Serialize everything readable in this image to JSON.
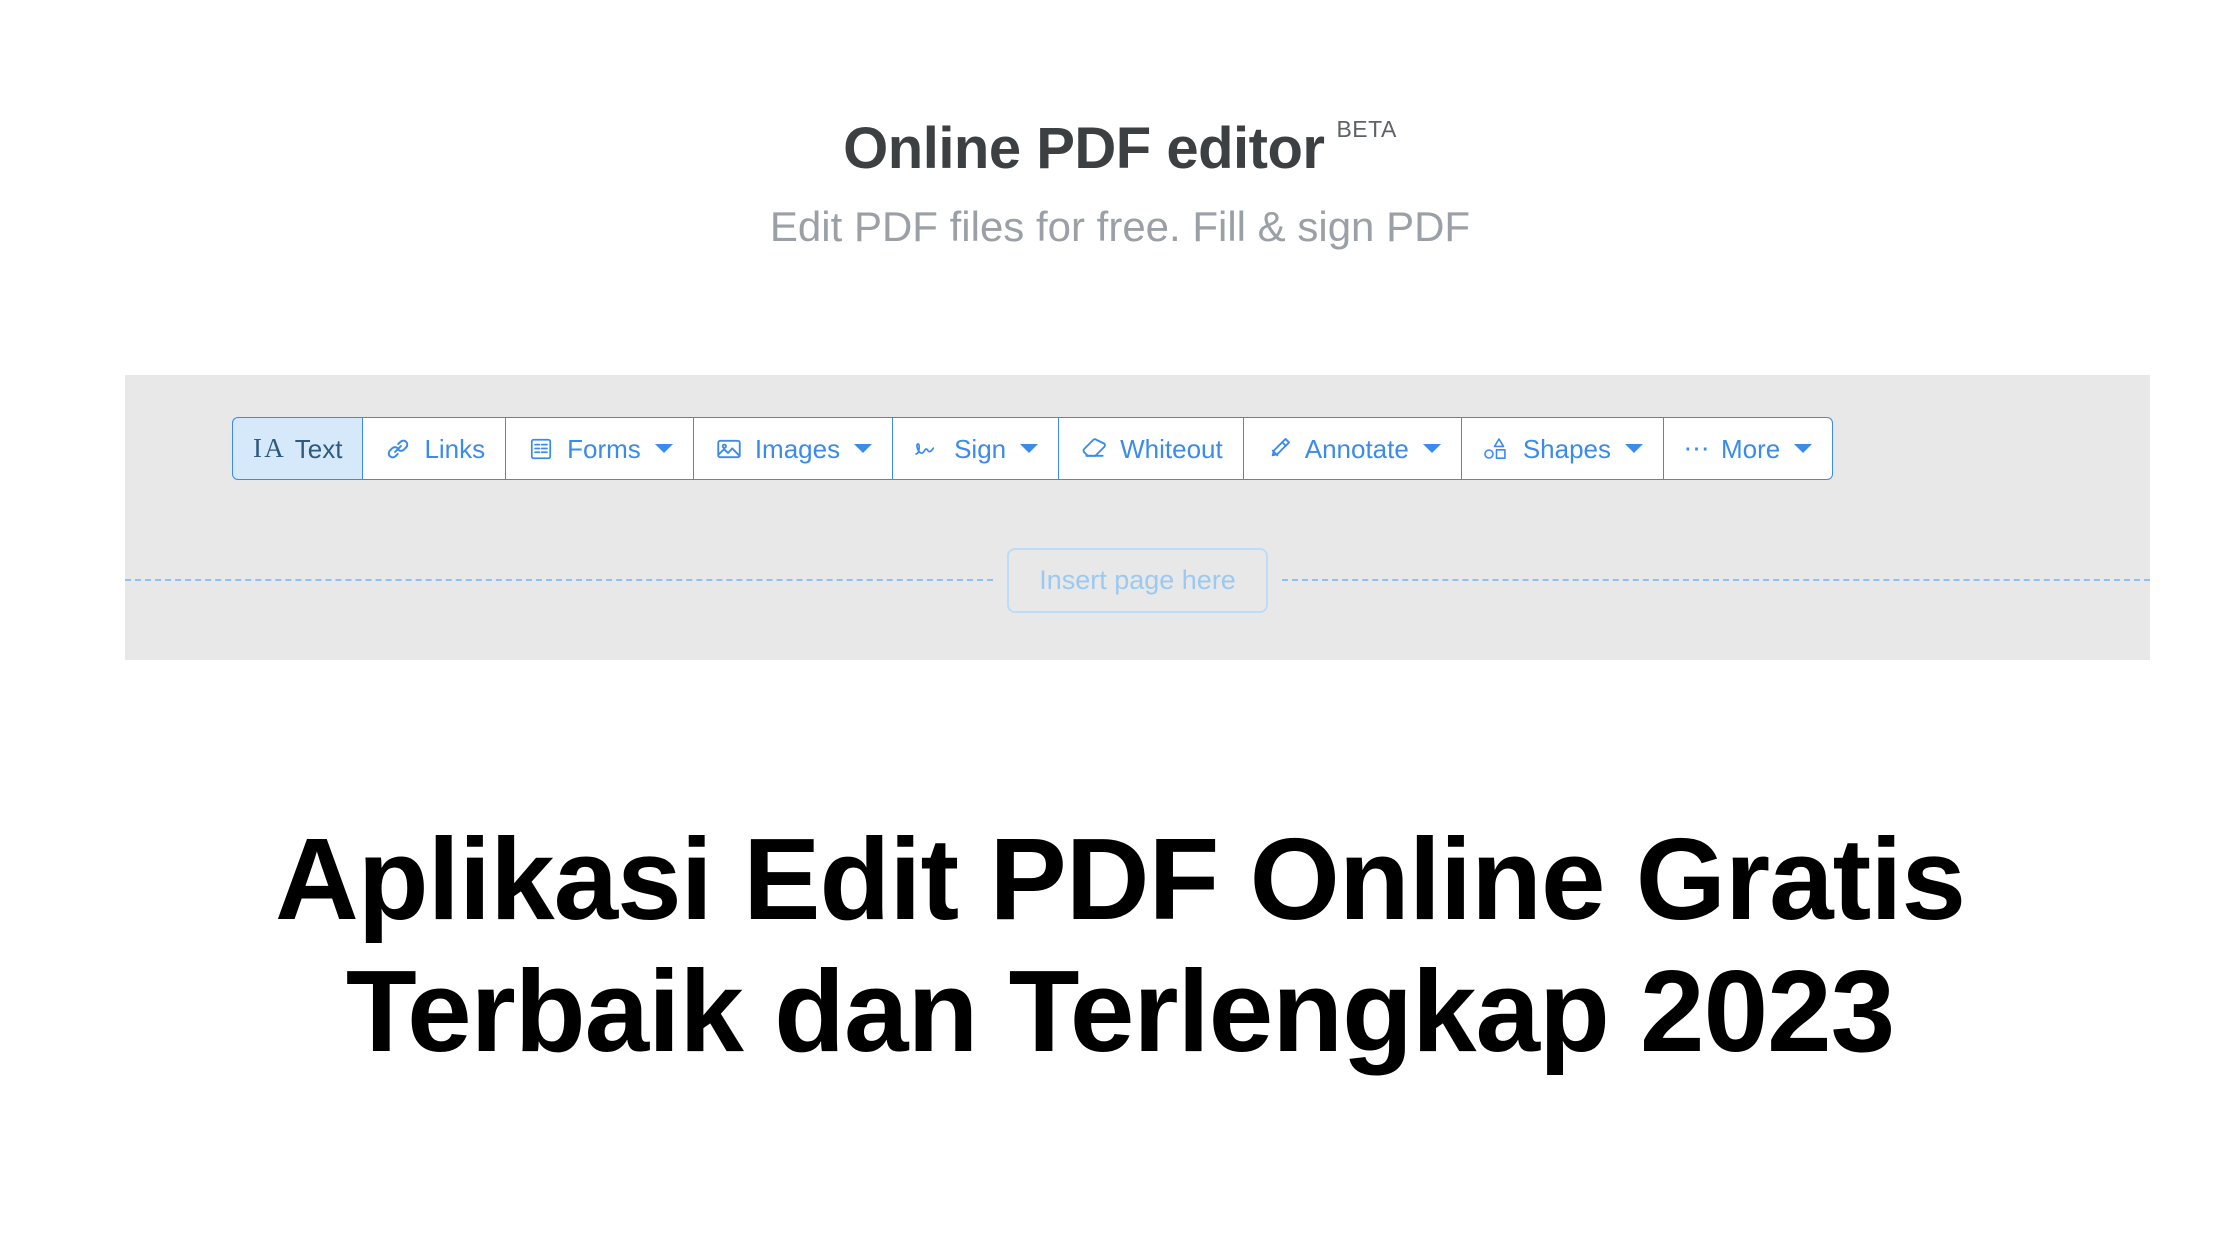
{
  "header": {
    "app_title": "Online PDF editor",
    "beta_badge": "BETA",
    "subtitle": "Edit PDF files for free. Fill & sign PDF"
  },
  "editor": {
    "toolbar": {
      "buttons": [
        {
          "label": "Text",
          "icon": "text-cursor-icon",
          "active": true,
          "caret": false
        },
        {
          "label": "Links",
          "icon": "link-icon",
          "active": false,
          "caret": false
        },
        {
          "label": "Forms",
          "icon": "form-icon",
          "active": false,
          "caret": true
        },
        {
          "label": "Images",
          "icon": "image-icon",
          "active": false,
          "caret": true
        },
        {
          "label": "Sign",
          "icon": "signature-icon",
          "active": false,
          "caret": true
        },
        {
          "label": "Whiteout",
          "icon": "eraser-icon",
          "active": false,
          "caret": false
        },
        {
          "label": "Annotate",
          "icon": "highlighter-icon",
          "active": false,
          "caret": true
        },
        {
          "label": "Shapes",
          "icon": "shapes-icon",
          "active": false,
          "caret": true
        },
        {
          "label": "More",
          "icon": "ellipsis-icon",
          "active": false,
          "caret": true
        }
      ]
    },
    "insert_page_label": "Insert page here"
  },
  "article": {
    "heading": "Aplikasi Edit PDF Online Gratis Terbaik dan Terlengkap 2023"
  },
  "colors": {
    "accent_blue": "#3b8beb",
    "active_tool_bg": "#d6e9fb",
    "panel_gray": "#e8e8e8",
    "title_dark": "#3c4043",
    "subtitle_gray": "#9aa0a6",
    "insert_border": "#bcdcf8"
  }
}
